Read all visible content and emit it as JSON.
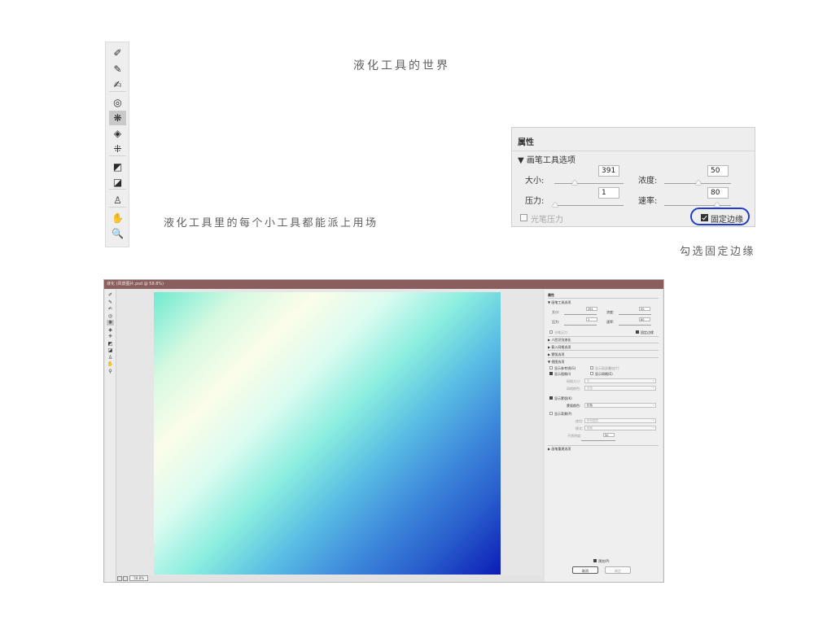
{
  "captions": {
    "world_title": "液化工具的世界",
    "tools_caption": "液化工具里的每个小工具都能派上用场",
    "check_caption": "勾选固定边缘"
  },
  "tool_strip": {
    "tools": [
      {
        "icon": "forward-warp-icon",
        "glyph": "✐"
      },
      {
        "icon": "reconstruct-icon",
        "glyph": "✎"
      },
      {
        "icon": "smooth-icon",
        "glyph": "✍"
      },
      {
        "icon": "twirl-icon",
        "glyph": "◎"
      },
      {
        "icon": "pucker-icon",
        "glyph": "❋"
      },
      {
        "icon": "bloat-icon",
        "glyph": "◈"
      },
      {
        "icon": "push-left-icon",
        "glyph": "⁜"
      },
      {
        "icon": "freeze-mask-icon",
        "glyph": "◩"
      },
      {
        "icon": "thaw-mask-icon",
        "glyph": "◪"
      },
      {
        "icon": "face-tool-icon",
        "glyph": "♙"
      },
      {
        "icon": "hand-icon",
        "glyph": "✋"
      },
      {
        "icon": "zoom-icon",
        "glyph": "🔍"
      }
    ],
    "active_index": 4
  },
  "properties_panel": {
    "title": "属性",
    "section": "▼ 画笔工具选项",
    "size_label": "大小:",
    "size_value": "391",
    "density_label": "浓度:",
    "density_value": "50",
    "pressure_label": "压力:",
    "pressure_value": "1",
    "rate_label": "速率:",
    "rate_value": "80",
    "stylus_label": "光笔压力",
    "pin_edges_label": "固定边缘",
    "pin_edges_checked": true,
    "stylus_checked": false
  },
  "dialog": {
    "title": "液化 (风景图片.psd @ 58.8%)",
    "zoom": "58.8%",
    "tools": [
      "✐",
      "✎",
      "✍",
      "◎",
      "❋",
      "◈",
      "⁜",
      "◩",
      "◪",
      "♙",
      "✋",
      "⚲"
    ],
    "active_tool": 4,
    "props": {
      "title": "属性",
      "brush_section": "▼ 画笔工具选项",
      "size_label": "大小:",
      "size_value": "391",
      "density_label": "浓度:",
      "density_value": "50",
      "pressure_label": "压力:",
      "pressure_value": "1",
      "rate_label": "速率:",
      "rate_value": "80",
      "stylus_label": "光笔压力",
      "pin_edges_label": "固定边缘",
      "face_aware": "▶ 人脸识别液化",
      "load_mesh": "▶ 载入网格选项",
      "mask_options": "▶ 蒙版选项",
      "view_options": "▼ 视图选项",
      "show_guides": "显示参考线(G)",
      "show_face_overlay": "显示面部叠加(Y)",
      "show_image": "显示图像(I)",
      "show_mesh": "显示网格(E)",
      "mesh_size_label": "网格大小:",
      "mesh_size_value": "中",
      "mesh_color_label": "网格颜色:",
      "mesh_color_value": "灰色",
      "show_mask": "显示蒙版(K)",
      "mask_color_label": "蒙版颜色:",
      "mask_color_value": "红色",
      "show_backdrop": "显示背景(P)",
      "use_label": "使用:",
      "use_value": "所有图层",
      "mode_label": "模式:",
      "mode_value": "前面",
      "opacity_label": "不透明度:",
      "opacity_value": "50",
      "brush_reconstruct": "▶ 画笔重建选项",
      "preview_label": "预览(P)",
      "cancel_label": "取消",
      "ok_label": "确定"
    }
  },
  "colors": {
    "highlight_ring": "#1e3fc9",
    "titlebar": "#8b5e5e",
    "gradient_start": "#6fead0",
    "gradient_end": "#0a1cb5"
  }
}
